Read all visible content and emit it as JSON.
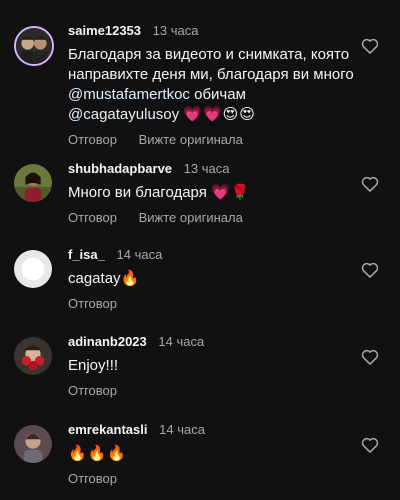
{
  "comments": [
    {
      "username": "saime12353",
      "time": "13 часа",
      "text_part1": "Благодаря за видеото и снимката, която направихте деня ми, благодаря ви много ",
      "mention1": "@mustafamertkoc",
      "text_part2": " обичам ",
      "mention2": "@cagatayulusoy",
      "emojis": "💗💗😍😍",
      "reply": "Отговор",
      "see_original": "Вижте оригинала"
    },
    {
      "username": "shubhadapbarve",
      "time": "13 часа",
      "text": "Много ви благодаря ",
      "emojis": "💗🌹",
      "reply": "Отговор",
      "see_original": "Вижте оригинала"
    },
    {
      "username": "f_isa_",
      "time": "14 часа",
      "text": "cagatay",
      "emojis": "🔥",
      "reply": "Отговор"
    },
    {
      "username": "adinanb2023",
      "time": "14 часа",
      "text": "Enjoy!!!",
      "reply": "Отговор"
    },
    {
      "username": "emrekantasli",
      "time": "14 часа",
      "emojis": "🔥🔥🔥",
      "reply": "Отговор"
    }
  ],
  "icons": {
    "like": "heart-outline-icon"
  },
  "colors": {
    "background": "#111111",
    "secondary_text": "#a8a8a8",
    "mention": "#e0f1ff"
  }
}
